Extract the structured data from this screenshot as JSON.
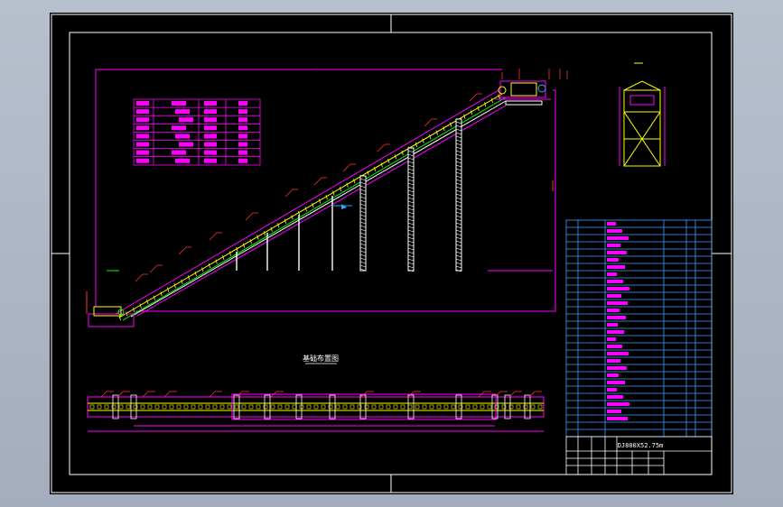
{
  "colors": {
    "viewport_bg": "#a9b3c2",
    "paper": "#000000",
    "frame": "#ffffff",
    "magenta": "#ff00ff",
    "yellow": "#ffff00",
    "green": "#00ff00",
    "blue": "#3aa0ff",
    "red": "#ff3030",
    "white": "#ffffff"
  },
  "labels": {
    "foundation_title": "基础布置图",
    "drawing_number": "DJ800X52.75m"
  }
}
